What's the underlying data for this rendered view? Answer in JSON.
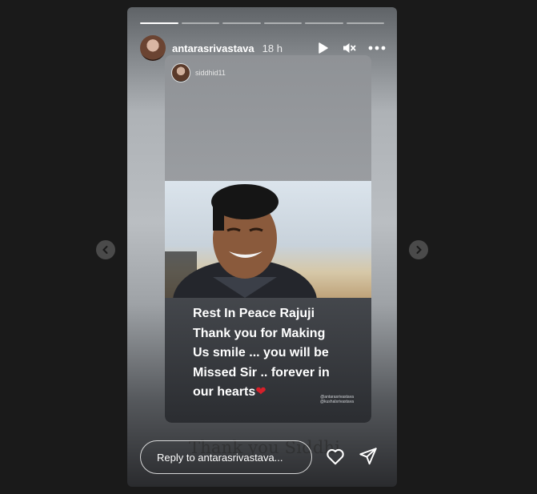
{
  "header": {
    "username": "antarasrivastava",
    "time": "18 h"
  },
  "progress": {
    "total": 6,
    "active": 1
  },
  "post": {
    "username": "siddhid11",
    "caption_lines": [
      "Rest In Peace Rajuji",
      "Thank you for Making",
      "Us smile ... you will be",
      "Missed Sir .. forever in",
      "our hearts"
    ],
    "tags": [
      "@antarasrivastava",
      "@kushalsrivastava"
    ]
  },
  "overlay_text": "Thank you Siddhi",
  "reply": {
    "placeholder": "Reply to antarasrivastava..."
  },
  "icons": {
    "play": "play-icon",
    "mute": "muted-speaker-icon",
    "more": "more-icon",
    "like": "heart-icon",
    "share": "paper-plane-icon",
    "prev": "chevron-left-icon",
    "next": "chevron-right-icon"
  },
  "colors": {
    "background": "#1a1a1a",
    "heart_emoji": "#d6202a"
  }
}
